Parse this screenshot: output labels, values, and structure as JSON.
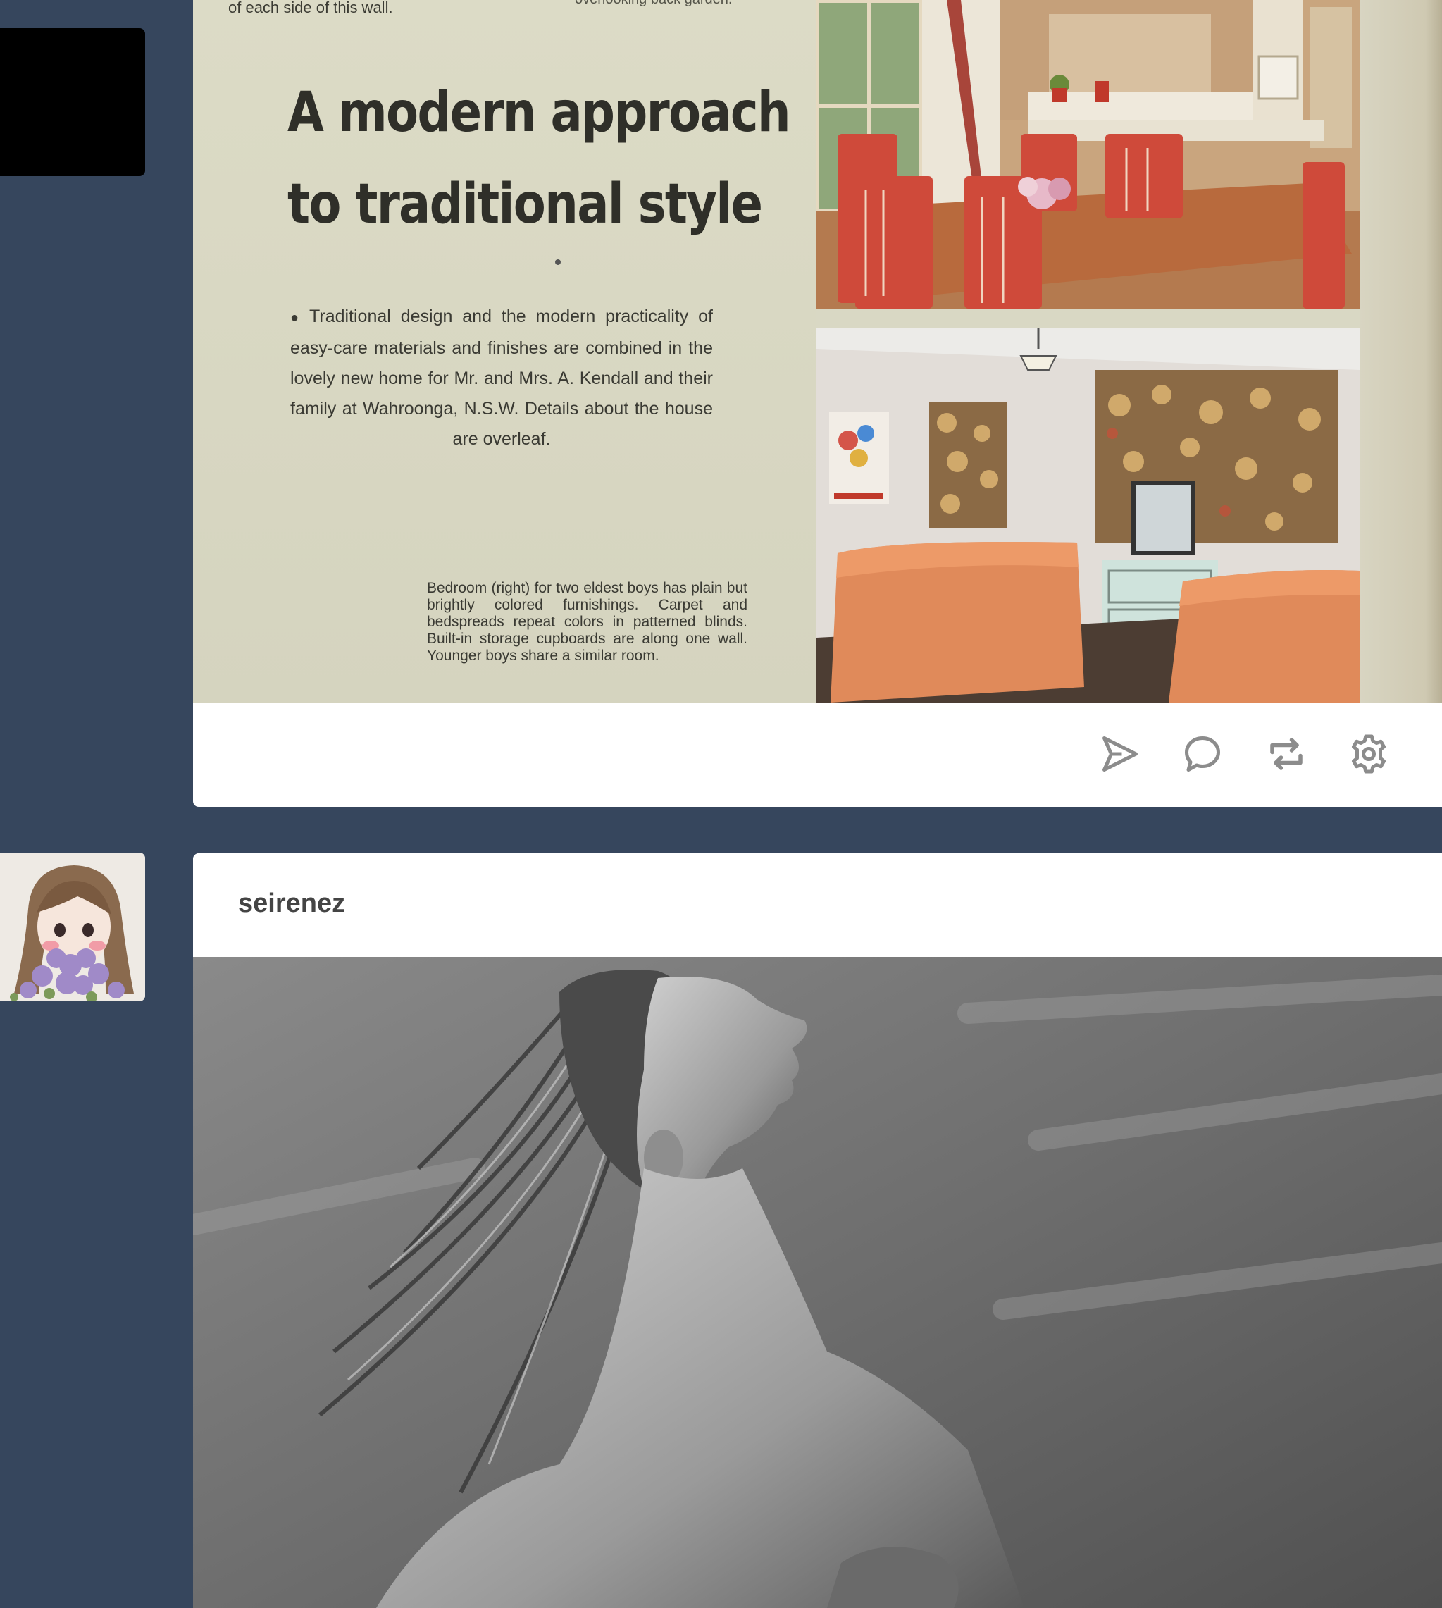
{
  "post1": {
    "magazine": {
      "top_left_text": "of each side of this wall.",
      "top_right_text": "overlooking back garden.",
      "heading_line1": "A modern approach",
      "heading_line2": "to traditional style",
      "body_bullet": "●",
      "body_text": "Traditional design and the modern practicality of easy-care materials and finishes are combined in the lovely new home for Mr. and Mrs. A. Kendall and their family at Wahroonga, N.S.W. Details about the house are overleaf.",
      "caption": "Bedroom (right) for two eldest boys has plain but brightly colored furnishings. Carpet and bedspreads repeat colors in patterned blinds. Built-in storage cupboards are along one wall. Younger boys share a similar room."
    },
    "actions": {
      "share_icon": "send-icon",
      "reply_icon": "comment-icon",
      "reblog_icon": "reblog-icon",
      "settings_icon": "gear-icon"
    }
  },
  "post2": {
    "blog_name": "seirenez"
  },
  "colors": {
    "dashboard_bg": "#36465d",
    "card_bg": "#ffffff",
    "icon_gray": "#8c8c8c"
  }
}
